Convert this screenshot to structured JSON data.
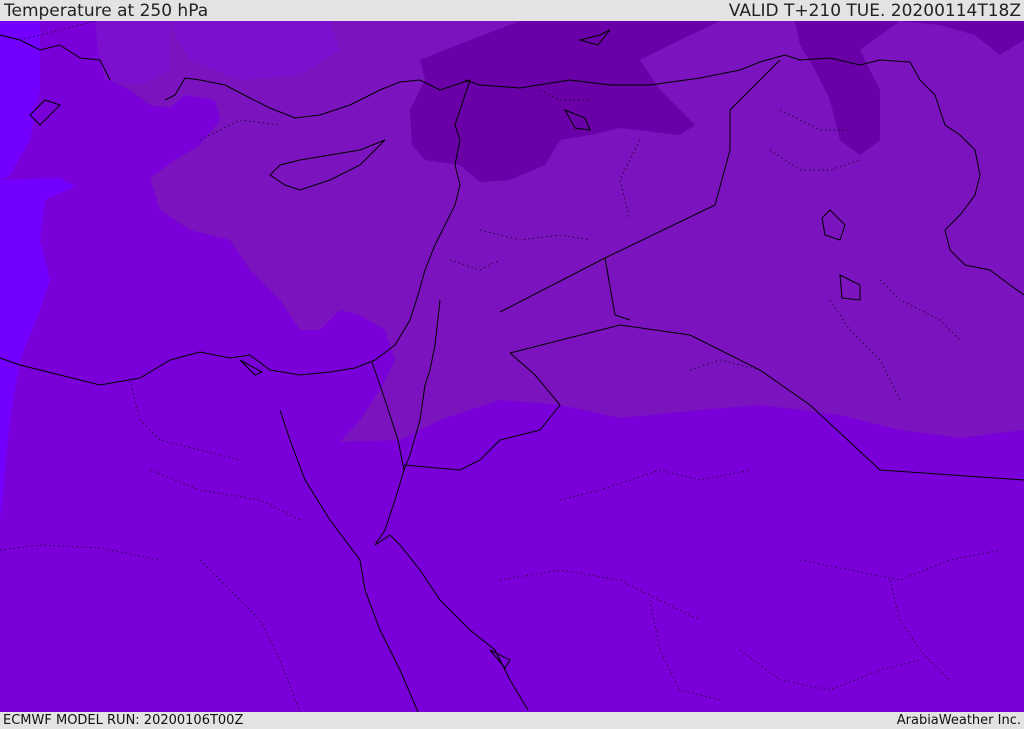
{
  "header": {
    "title": "Temperature at 250 hPa",
    "valid_time": "VALID T+210 TUE. 20200114T18Z"
  },
  "footer": {
    "model_run": "ECMWF MODEL RUN: 20200106T00Z",
    "credit": "ArabiaWeather Inc."
  },
  "colors": {
    "background_fill": "#7a00d9",
    "west_band": "#7200ff",
    "mid_band": "#7a14bf",
    "north_band": "#6a00a6",
    "band_lighter": "#7d0fcf",
    "coastline": "#000000",
    "header_background": "#e3e3e3"
  }
}
